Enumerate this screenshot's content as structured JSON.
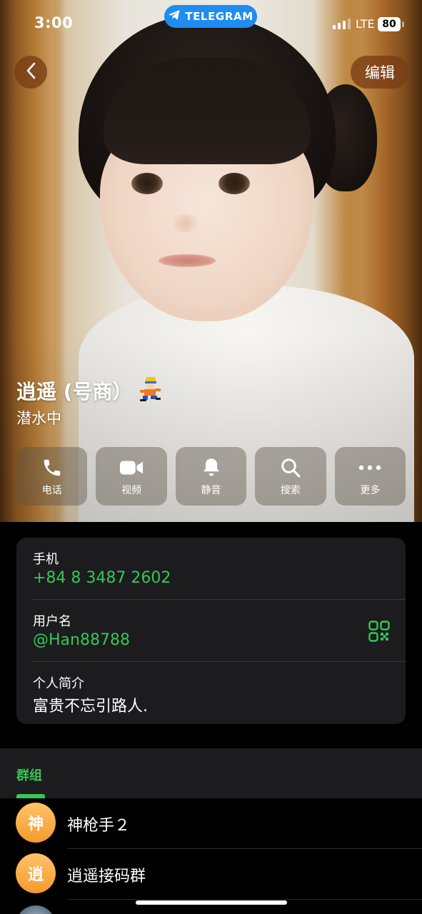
{
  "status_bar": {
    "time": "3:00",
    "app_pill": "TELEGRAM",
    "network": "LTE",
    "battery": "80"
  },
  "nav": {
    "edit_label": "编辑"
  },
  "profile": {
    "name": "逍遥 (号商）",
    "status": "潜水中"
  },
  "actions": [
    {
      "label": "电话",
      "icon": "phone-icon"
    },
    {
      "label": "视频",
      "icon": "video-icon"
    },
    {
      "label": "静音",
      "icon": "bell-icon"
    },
    {
      "label": "搜索",
      "icon": "search-icon"
    },
    {
      "label": "更多",
      "icon": "more-icon"
    }
  ],
  "info": {
    "phone_label": "手机",
    "phone_value": "+84 8 3487 2602",
    "username_label": "用户名",
    "username_value": "@Han88788",
    "bio_label": "个人简介",
    "bio_value": "富贵不忘引路人."
  },
  "groups": {
    "title": "群组",
    "items": [
      {
        "avatar_letter": "神",
        "name": "神枪手２"
      },
      {
        "avatar_letter": "逍",
        "name": "逍遥接码群"
      }
    ]
  },
  "colors": {
    "accent_green": "#34c759",
    "telegram_blue": "#1f8cf0",
    "card_bg": "#1c1c1e",
    "avatar_orange": "#f49a2c"
  }
}
